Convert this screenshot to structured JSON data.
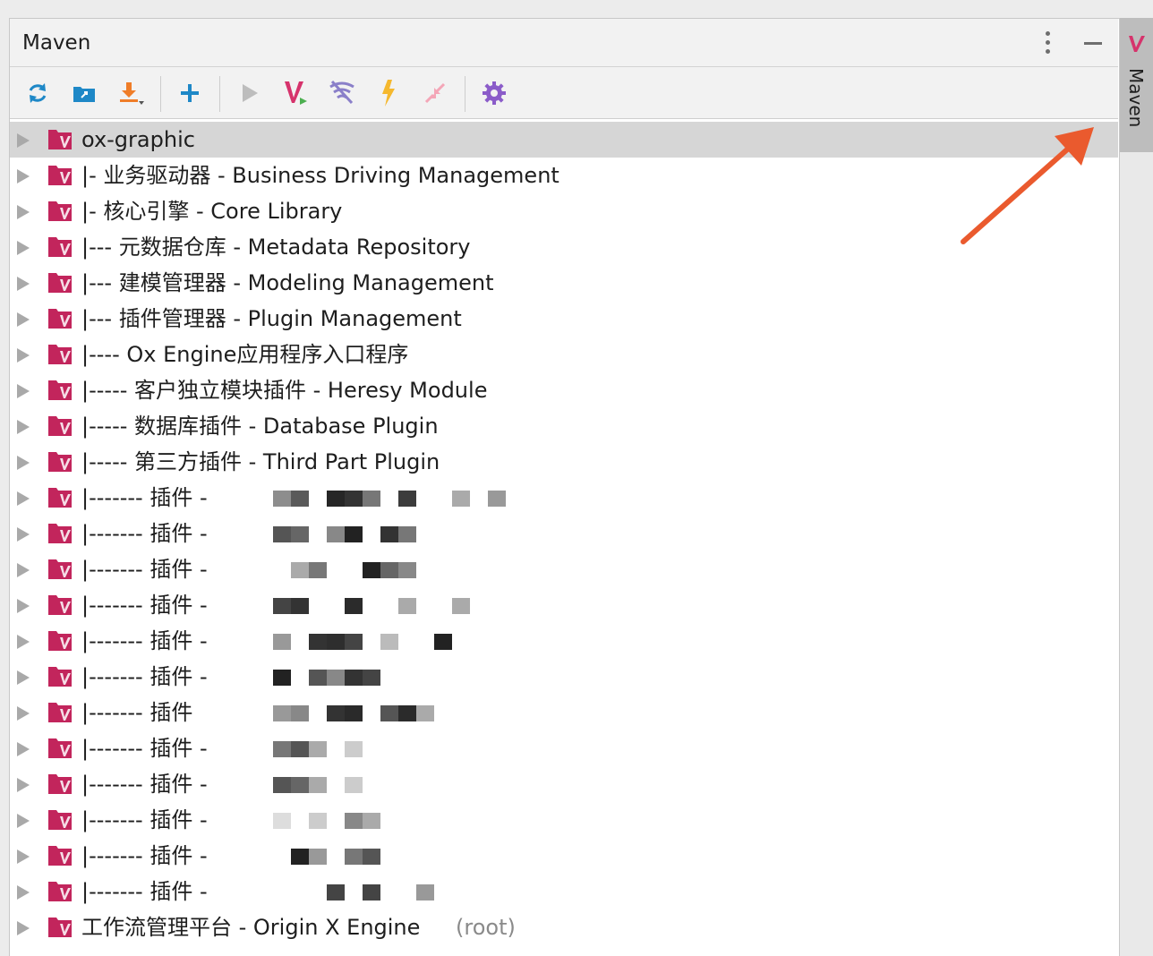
{
  "panel": {
    "title": "Maven"
  },
  "stripe": {
    "label": "Maven"
  },
  "toolbar": {
    "icons": [
      "reload-icon",
      "generate-sources-icon",
      "download-icon",
      "add-icon",
      "run-icon",
      "execute-goal-icon",
      "toggle-offline-icon",
      "skip-tests-icon",
      "collapse-all-icon",
      "settings-icon"
    ]
  },
  "tree": {
    "rows": [
      {
        "label": "ox-graphic"
      },
      {
        "label": "|- 业务驱动器 - Business Driving Management"
      },
      {
        "label": "|- 核心引擎 - Core Library"
      },
      {
        "label": "|--- 元数据仓库 - Metadata Repository"
      },
      {
        "label": "|--- 建模管理器 - Modeling Management"
      },
      {
        "label": "|--- 插件管理器 - Plugin Management"
      },
      {
        "label": "|---- Ox Engine应用程序入口程序"
      },
      {
        "label": "|----- 客户独立模块插件 - Heresy Module"
      },
      {
        "label": "|----- 数据库插件 - Database Plugin"
      },
      {
        "label": "|----- 第三方插件 - Third Part Plugin"
      },
      {
        "label": "|------- 插件 -"
      },
      {
        "label": "|------- 插件 -"
      },
      {
        "label": "|------- 插件 -"
      },
      {
        "label": "|------- 插件 -"
      },
      {
        "label": "|------- 插件 -"
      },
      {
        "label": "|------- 插件 -"
      },
      {
        "label": "|------- 插件"
      },
      {
        "label": "|------- 插件 -"
      },
      {
        "label": "|------- 插件 -"
      },
      {
        "label": "|------- 插件 -"
      },
      {
        "label": "|------- 插件 -"
      },
      {
        "label": "|------- 插件 -"
      },
      {
        "label": "工作流管理平台 - Origin X Engine",
        "suffix": "(root)"
      }
    ]
  },
  "colors": {
    "module_icon": "#c2255c",
    "arrow_annotation": "#ea5a2e",
    "maven_accent": "#d6336c"
  }
}
